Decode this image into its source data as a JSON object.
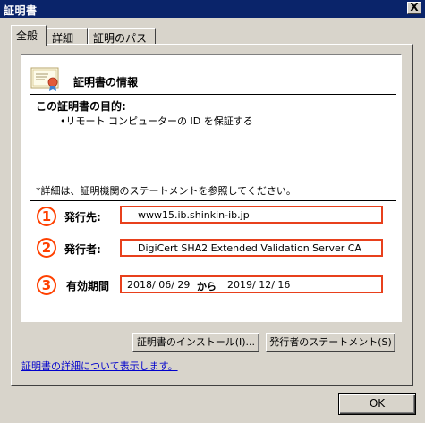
{
  "window": {
    "title": "証明書",
    "close_label": "X"
  },
  "tabs": [
    {
      "label": "全般",
      "active": true
    },
    {
      "label": "詳細",
      "active": false
    },
    {
      "label": "証明のパス",
      "active": false
    }
  ],
  "info": {
    "icon": "certificate-icon",
    "title": "証明書の情報",
    "purpose_label": "この証明書の目的:",
    "purpose_items": [
      "•リモート コンピューターの ID を保証する"
    ],
    "note": "*詳細は、証明機関のステートメントを参照してください。"
  },
  "rows": {
    "issued_to": {
      "number": "1",
      "label": "発行先:",
      "value": "www15.ib.shinkin-ib.jp"
    },
    "issued_by": {
      "number": "2",
      "label": "発行者:",
      "value": "DigiCert SHA2 Extended Validation Server CA"
    },
    "validity": {
      "number": "3",
      "label": "有効期間",
      "from": "2018/ 06/ 29",
      "from_word": "から",
      "to": "2019/ 12/ 16"
    }
  },
  "buttons": {
    "install": "証明書のインストール(I)...",
    "issuer_statement": "発行者のステートメント(S)",
    "ok": "OK"
  },
  "link": "証明書の詳細について表示します。",
  "colors": {
    "titlebar": "#0a246a",
    "highlight": "#ff4000",
    "link": "#0000cc"
  }
}
